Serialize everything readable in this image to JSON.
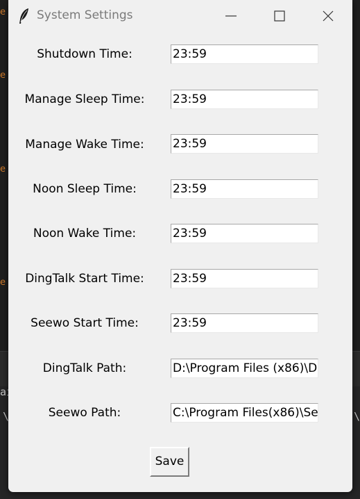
{
  "window": {
    "title": "System Settings",
    "app_icon": "feather-icon",
    "controls": {
      "minimize_icon": "minimize-icon",
      "maximize_icon": "maximize-icon",
      "close_icon": "close-icon"
    }
  },
  "fields": [
    {
      "key": "shutdown_time",
      "label": "Shutdown Time:",
      "value": "23:59"
    },
    {
      "key": "manage_sleep_time",
      "label": "Manage Sleep Time:",
      "value": "23:59"
    },
    {
      "key": "manage_wake_time",
      "label": "Manage Wake Time:",
      "value": "23:59"
    },
    {
      "key": "noon_sleep_time",
      "label": "Noon Sleep Time:",
      "value": "23:59"
    },
    {
      "key": "noon_wake_time",
      "label": "Noon Wake Time:",
      "value": "23:59"
    },
    {
      "key": "dingtalk_start_time",
      "label": "DingTalk Start Time:",
      "value": "23:59"
    },
    {
      "key": "seewo_start_time",
      "label": "Seewo Start Time:",
      "value": "23:59"
    },
    {
      "key": "dingtalk_path",
      "label": "DingTalk Path:",
      "value": "D:\\Program Files (x86)\\D"
    },
    {
      "key": "seewo_path",
      "label": "Seewo Path:",
      "value": "C:\\Program Files(x86)\\Se"
    }
  ],
  "save_label": "Save",
  "background": {
    "band_text_left": "ai",
    "slash_left": "\\",
    "slash_right": "\\"
  },
  "colors": {
    "window_bg": "#f0f0f0",
    "title_text": "#7a7a7a",
    "desktop_bg": "#1f1f1f",
    "accent_marks": "#d07a2a"
  }
}
